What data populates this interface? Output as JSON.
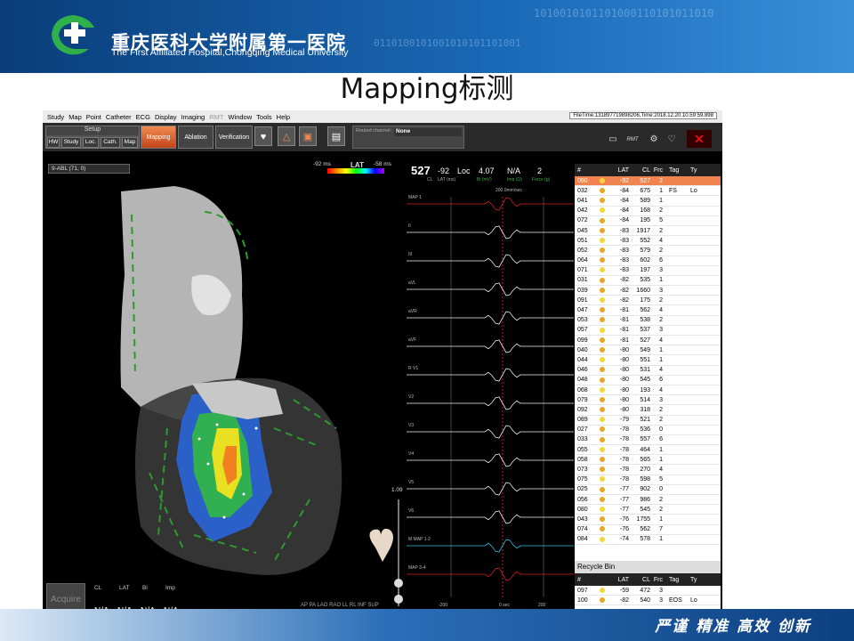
{
  "slide": {
    "hospital_cn": "重庆医科大学附属第一医院",
    "hospital_en": "The First Affiliated Hospital,Chongqing Medical University",
    "title": "Mapping标测",
    "slogan": "严谨 精准 高效 创新",
    "binary_top": "1010010101101000110101011010",
    "binary_mid": "0110100101001010101101001"
  },
  "app": {
    "menu": [
      "Study",
      "Map",
      "Point",
      "Catheter",
      "ECG",
      "Display",
      "Imaging",
      "RMT",
      "Window",
      "Tools",
      "Help"
    ],
    "menu_disabled": "RMT",
    "file_time": "FileTime:131897719898206,Time:2018.12.20.10.59:59.898",
    "setup_label": "Setup",
    "setup_buttons": [
      "HW",
      "Study",
      "Loc.",
      "Cath.",
      "Map"
    ],
    "mode_buttons": {
      "mapping": "Mapping",
      "ablation": "Ablation",
      "verification": "Verification"
    },
    "routed_label": "Routed channel:",
    "routed_value": "None",
    "rmt_label": "RMT"
  },
  "map": {
    "catheter": "9-ABL (71, 0)",
    "lat_label": "LAT",
    "lat_min": "-92 ms",
    "lat_max": "-58 ms",
    "zoom": "1.09",
    "orientations": "AP PA LAO RAO LL RL INF SUP",
    "acquire": "Acquire",
    "readout_labels": {
      "cl": "CL",
      "lat": "LAT",
      "bi": "Bi",
      "imp": "Imp"
    },
    "readout_values": {
      "cl": "N/A",
      "lat": "N/A",
      "bi": "N/A",
      "imp": "N/A"
    }
  },
  "ecg": {
    "cl_value": "527",
    "lat_value": "-92",
    "loc_label": "Loc",
    "bi_value": "4.07",
    "imp_value": "N/A",
    "force_value": "2",
    "cl_unit": "CL",
    "lat_unit": "LAT (ms)",
    "bi_unit": "Bi (mV)",
    "imp_unit": "Imp (Ω)",
    "force_unit": "Force (g)",
    "speed": "200.0mm/sec",
    "channels": [
      "MAP 1",
      "II",
      "III",
      "aVL",
      "aVR",
      "aVF",
      "R V1",
      "V2",
      "V3",
      "V4",
      "V5",
      "V6",
      "M MAP 1-2",
      "MAP 3-4"
    ],
    "time_left": "-200",
    "time_center": "0 sec",
    "time_right": "200"
  },
  "points_table": {
    "headers": [
      "#",
      "",
      "LAT",
      "CL",
      "Frc",
      "Tag",
      "Ty"
    ],
    "rows": [
      {
        "id": "090",
        "lat": "-92",
        "cl": "527",
        "frc": "2",
        "tag": "",
        "ty": "",
        "sel": true
      },
      {
        "id": "032",
        "lat": "-84",
        "cl": "675",
        "frc": "1",
        "tag": "FS",
        "ty": "Lo"
      },
      {
        "id": "041",
        "lat": "-84",
        "cl": "589",
        "frc": "1",
        "tag": "",
        "ty": ""
      },
      {
        "id": "042",
        "lat": "-84",
        "cl": "168",
        "frc": "2",
        "tag": "",
        "ty": ""
      },
      {
        "id": "072",
        "lat": "-84",
        "cl": "195",
        "frc": "5",
        "tag": "",
        "ty": ""
      },
      {
        "id": "045",
        "lat": "-83",
        "cl": "1917",
        "frc": "2",
        "tag": "",
        "ty": ""
      },
      {
        "id": "051",
        "lat": "-83",
        "cl": "552",
        "frc": "4",
        "tag": "",
        "ty": ""
      },
      {
        "id": "052",
        "lat": "-83",
        "cl": "579",
        "frc": "2",
        "tag": "",
        "ty": ""
      },
      {
        "id": "064",
        "lat": "-83",
        "cl": "602",
        "frc": "6",
        "tag": "",
        "ty": ""
      },
      {
        "id": "071",
        "lat": "-83",
        "cl": "197",
        "frc": "3",
        "tag": "",
        "ty": ""
      },
      {
        "id": "031",
        "lat": "-82",
        "cl": "535",
        "frc": "1",
        "tag": "",
        "ty": ""
      },
      {
        "id": "039",
        "lat": "-82",
        "cl": "1660",
        "frc": "3",
        "tag": "",
        "ty": ""
      },
      {
        "id": "091",
        "lat": "-82",
        "cl": "175",
        "frc": "2",
        "tag": "",
        "ty": ""
      },
      {
        "id": "047",
        "lat": "-81",
        "cl": "562",
        "frc": "4",
        "tag": "",
        "ty": ""
      },
      {
        "id": "053",
        "lat": "-81",
        "cl": "538",
        "frc": "2",
        "tag": "",
        "ty": ""
      },
      {
        "id": "057",
        "lat": "-81",
        "cl": "537",
        "frc": "3",
        "tag": "",
        "ty": ""
      },
      {
        "id": "099",
        "lat": "-81",
        "cl": "527",
        "frc": "4",
        "tag": "",
        "ty": ""
      },
      {
        "id": "040",
        "lat": "-80",
        "cl": "549",
        "frc": "1",
        "tag": "",
        "ty": ""
      },
      {
        "id": "044",
        "lat": "-80",
        "cl": "551",
        "frc": "1",
        "tag": "",
        "ty": ""
      },
      {
        "id": "046",
        "lat": "-80",
        "cl": "531",
        "frc": "4",
        "tag": "",
        "ty": ""
      },
      {
        "id": "048",
        "lat": "-80",
        "cl": "545",
        "frc": "6",
        "tag": "",
        "ty": ""
      },
      {
        "id": "068",
        "lat": "-80",
        "cl": "193",
        "frc": "4",
        "tag": "",
        "ty": ""
      },
      {
        "id": "079",
        "lat": "-80",
        "cl": "514",
        "frc": "3",
        "tag": "",
        "ty": ""
      },
      {
        "id": "092",
        "lat": "-80",
        "cl": "318",
        "frc": "2",
        "tag": "",
        "ty": ""
      },
      {
        "id": "089",
        "lat": "-79",
        "cl": "521",
        "frc": "2",
        "tag": "",
        "ty": ""
      },
      {
        "id": "027",
        "lat": "-78",
        "cl": "536",
        "frc": "0",
        "tag": "",
        "ty": ""
      },
      {
        "id": "033",
        "lat": "-78",
        "cl": "557",
        "frc": "6",
        "tag": "",
        "ty": ""
      },
      {
        "id": "055",
        "lat": "-78",
        "cl": "464",
        "frc": "1",
        "tag": "",
        "ty": ""
      },
      {
        "id": "058",
        "lat": "-78",
        "cl": "565",
        "frc": "1",
        "tag": "",
        "ty": ""
      },
      {
        "id": "073",
        "lat": "-78",
        "cl": "270",
        "frc": "4",
        "tag": "",
        "ty": ""
      },
      {
        "id": "075",
        "lat": "-78",
        "cl": "598",
        "frc": "5",
        "tag": "",
        "ty": ""
      },
      {
        "id": "025",
        "lat": "-77",
        "cl": "902",
        "frc": "0",
        "tag": "",
        "ty": ""
      },
      {
        "id": "056",
        "lat": "-77",
        "cl": "986",
        "frc": "2",
        "tag": "",
        "ty": ""
      },
      {
        "id": "080",
        "lat": "-77",
        "cl": "545",
        "frc": "2",
        "tag": "",
        "ty": ""
      },
      {
        "id": "043",
        "lat": "-76",
        "cl": "1755",
        "frc": "1",
        "tag": "",
        "ty": ""
      },
      {
        "id": "074",
        "lat": "-76",
        "cl": "562",
        "frc": "7",
        "tag": "",
        "ty": ""
      },
      {
        "id": "084",
        "lat": "-74",
        "cl": "578",
        "frc": "1",
        "tag": "",
        "ty": ""
      }
    ]
  },
  "recycle_bin": {
    "title": "Recycle Bin",
    "headers": [
      "#",
      "",
      "LAT",
      "CL",
      "Frc",
      "Tag",
      "Ty"
    ],
    "rows": [
      {
        "id": "097",
        "lat": "-59",
        "cl": "472",
        "frc": "3",
        "tag": "",
        "ty": ""
      },
      {
        "id": "100",
        "lat": "-82",
        "cl": "540",
        "frc": "3",
        "tag": "EOS",
        "ty": "Lo"
      }
    ]
  }
}
